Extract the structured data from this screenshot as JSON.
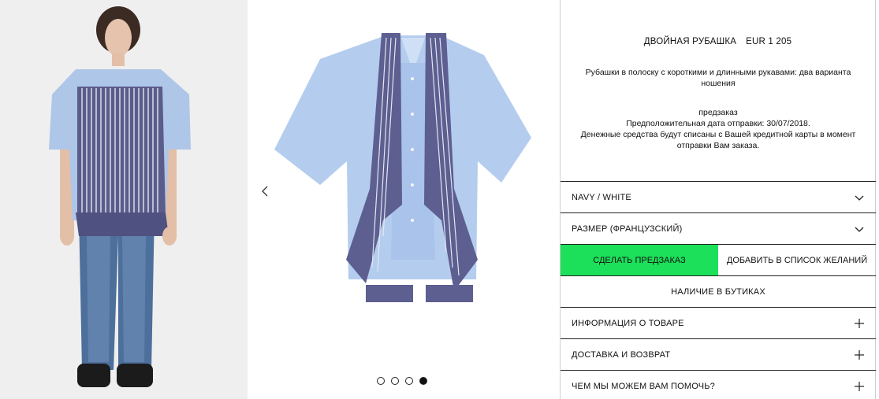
{
  "product": {
    "name": "ДВОЙНАЯ РУБАШКА",
    "price": "EUR 1 205",
    "description": "Рубашки в полоску с короткими и длинными рукавами: два варианта ношения",
    "preorder_label": "предзаказ",
    "shipping_date": "Предположительная дата отправки: 30/07/2018.",
    "charge_note": "Денежные средства будут списаны с Вашей кредитной карты в момент отправки Вам заказа."
  },
  "options": {
    "color": "NAVY / WHITE",
    "size_label": "РАЗМЕР (ФРАНЦУЗСКИЙ)"
  },
  "actions": {
    "preorder_button": "СДЕЛАТЬ ПРЕДЗАКАЗ",
    "wishlist_button": "ДОБАВИТЬ В СПИСОК ЖЕЛАНИЙ",
    "boutique_availability": "НАЛИЧИЕ В БУТИКАХ",
    "accent_color": "#1ce05a"
  },
  "accordion": [
    {
      "label": "ИНФОРМАЦИЯ О ТОВАРЕ"
    },
    {
      "label": "ДОСТАВКА И ВОЗВРАТ"
    },
    {
      "label": "ЧЕМ МЫ МОЖЕМ ВАМ ПОМОЧЬ?"
    }
  ],
  "gallery": {
    "prev_icon": "chevron-left-icon",
    "slide_count": 4,
    "active_slide": 4
  }
}
